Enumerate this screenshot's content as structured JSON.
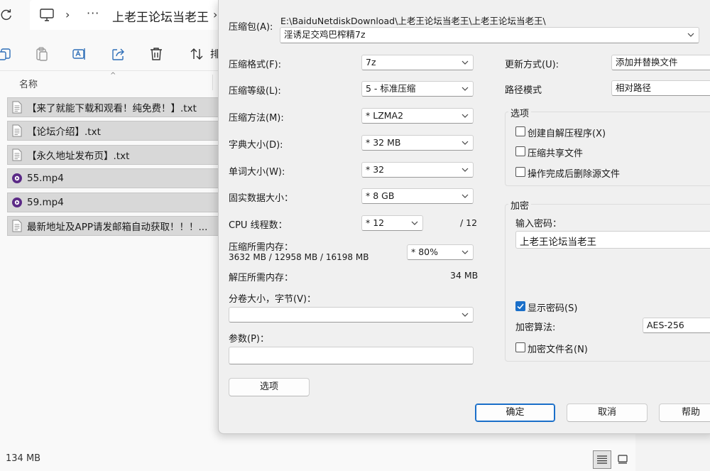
{
  "explorer": {
    "breadcrumb": {
      "more": "···",
      "separator": "›",
      "folder": "上老王论坛当老王"
    },
    "toolbar": {
      "sort_label": "排"
    },
    "columns": {
      "name": "名称"
    },
    "files": [
      {
        "name": "【来了就能下载和观看！纯免费！】.txt",
        "type": "txt"
      },
      {
        "name": "【论坛介绍】.txt",
        "type": "txt"
      },
      {
        "name": "【永久地址发布页】.txt",
        "type": "txt"
      },
      {
        "name": "55.mp4",
        "type": "mp4"
      },
      {
        "name": "59.mp4",
        "type": "mp4"
      },
      {
        "name": "最新地址及APP请发邮箱自动获取！！！...",
        "type": "txt"
      }
    ],
    "status": {
      "size": "134 MB"
    }
  },
  "dialog": {
    "archive_label": "压缩包(A):",
    "archive_path": "E:\\BaiduNetdiskDownload\\上老王论坛当老王\\上老王论坛当老王\\",
    "archive_name": "淫诱足交鸡巴榨精7z",
    "format_label": "压缩格式(F):",
    "format_value": "7z",
    "level_label": "压缩等级(L):",
    "level_value": "5 - 标准压缩",
    "method_label": "压缩方法(M):",
    "method_value": "* LZMA2",
    "dict_label": "字典大小(D):",
    "dict_value": "* 32 MB",
    "word_label": "单词大小(W):",
    "word_value": "* 32",
    "solid_label": "固实数据大小：",
    "solid_value": "* 8 GB",
    "cpu_label": "CPU 线程数：",
    "cpu_value": "* 12",
    "cpu_max": "/ 12",
    "mem_label": "压缩所需内存：",
    "mem_detail": "3632 MB / 12958 MB / 16198 MB",
    "mem_value": "* 80%",
    "decomp_label": "解压所需内存：",
    "decomp_value": "34 MB",
    "split_label": "分卷大小，字节(V)：",
    "split_value": "",
    "params_label": "参数(P)：",
    "params_value": "",
    "options_button": "选项",
    "update_label": "更新方式(U):",
    "update_value": "添加并替换文件",
    "path_mode_label": "路径模式",
    "path_mode_value": "相对路径",
    "options_group": "选项",
    "opt_sfx": "创建自解压程序(X)",
    "opt_shared": "压缩共享文件",
    "opt_delete": "操作完成后删除源文件",
    "encrypt_group": "加密",
    "password_label": "输入密码：",
    "password_value": "上老王论坛当老王",
    "show_password": "显示密码(S)",
    "show_password_checked": true,
    "enc_method_label": "加密算法:",
    "enc_method_value": "AES-256",
    "encrypt_names": "加密文件名(N)",
    "ok_button": "确定",
    "cancel_button": "取消",
    "help_button": "帮助"
  },
  "colors": {
    "accent": "#1a6fc9",
    "video_icon": "#5b2a86"
  }
}
